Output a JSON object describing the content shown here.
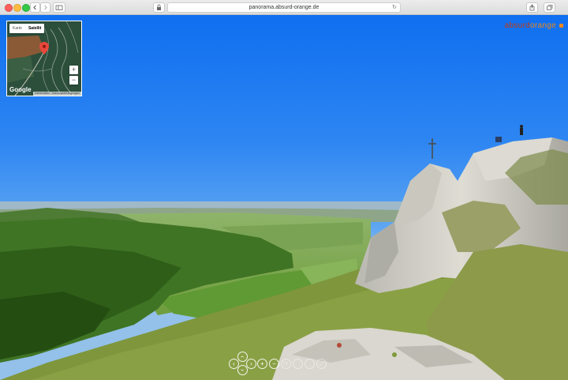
{
  "browser": {
    "url": "panorama.absurd-orange.de",
    "colors": {
      "close": "#fc605c",
      "minimize": "#fdbc40",
      "zoom": "#34c84a"
    }
  },
  "brand": {
    "part1": "absurd",
    "part2": "orange",
    "color1": "#c23a12",
    "color2": "#e9861c"
  },
  "map": {
    "tabs": [
      "Karte",
      "Satellit"
    ],
    "active_tab": "Satellit",
    "zoom_in": "+",
    "zoom_out": "−",
    "logo": "Google",
    "attribution": "Kartendaten  |  Nutzungsbedingungen"
  },
  "controls": {
    "up": "‹",
    "left": "‹",
    "right": "›",
    "down": "›",
    "zoom_in": "+",
    "zoom_out": "−",
    "autorotate": "⟳",
    "fullscreen": "⤢"
  }
}
